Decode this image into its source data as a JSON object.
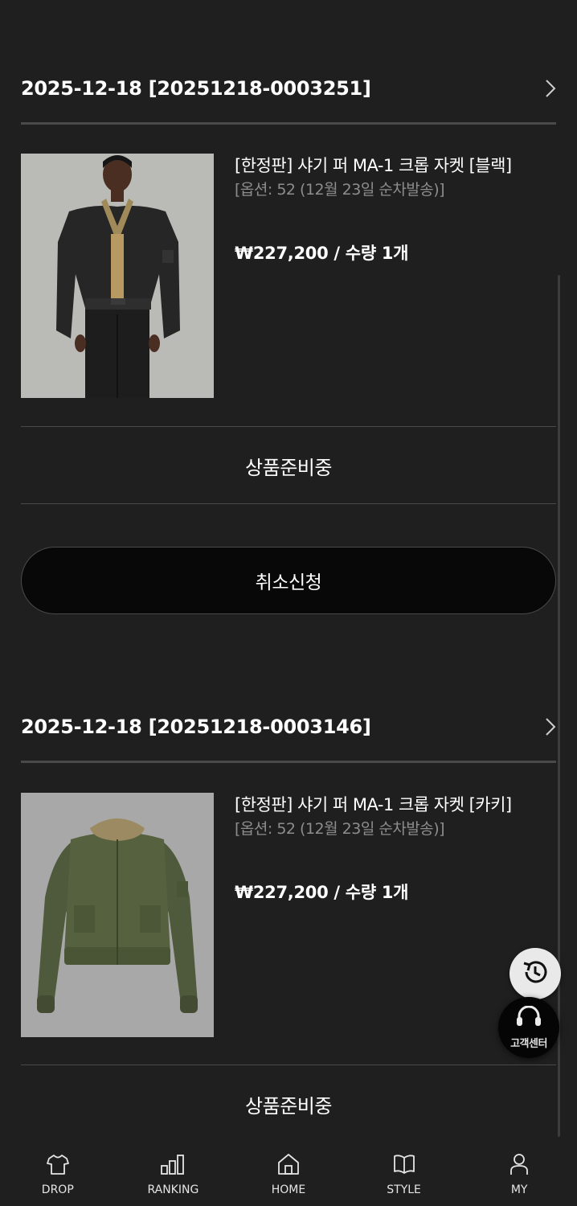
{
  "orders": [
    {
      "order_id": "2025-12-18 [20251218-0003251]",
      "product_name": "[한정판] 샤기 퍼 MA-1 크롭 자켓 [블랙]",
      "option": "[옵션: 52 (12월 23일 순차발송)]",
      "price_qty": "₩227,200 /  수량 1개",
      "status": "상품준비중",
      "cancel_label": "취소신청"
    },
    {
      "order_id": "2025-12-18 [20251218-0003146]",
      "product_name": "[한정판] 샤기 퍼 MA-1 크롭 자켓 [카키]",
      "option": "[옵션: 52 (12월 23일 순차발송)]",
      "price_qty": "₩227,200 /  수량 1개",
      "status": "상품준비중"
    }
  ],
  "floating": {
    "customer_center_label": "고객센터",
    "recent_icon": "history-icon",
    "cs_icon": "headset-icon"
  },
  "tabbar": [
    {
      "label": "DROP",
      "icon": "tshirt-icon"
    },
    {
      "label": "RANKING",
      "icon": "bar-chart-icon"
    },
    {
      "label": "HOME",
      "icon": "home-icon"
    },
    {
      "label": "STYLE",
      "icon": "book-icon"
    },
    {
      "label": "MY",
      "icon": "person-icon"
    }
  ],
  "colors": {
    "background": "#1f1f1f",
    "divider": "#4a4a4a",
    "option_text": "#8d8d8d",
    "button_bg": "#080808"
  }
}
